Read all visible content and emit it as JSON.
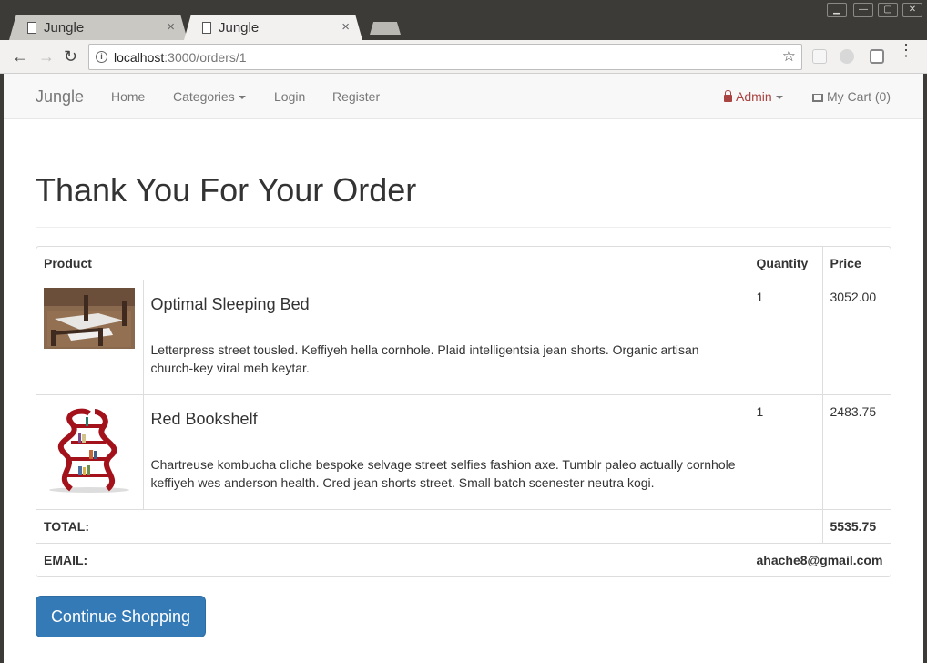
{
  "browser": {
    "tabs": [
      {
        "title": "Jungle",
        "close": "×"
      },
      {
        "title": "Jungle",
        "close": "×"
      }
    ],
    "url_host": "localhost",
    "url_path": ":3000/orders/1",
    "nav": {
      "back": "←",
      "forward": "→",
      "reload": "↻",
      "star": "☆",
      "menu": "⋮",
      "info": "i"
    },
    "window_controls": [
      "▁",
      "—",
      "▢",
      "✕"
    ]
  },
  "navbar": {
    "brand": "Jungle",
    "links": {
      "home": "Home",
      "categories": "Categories",
      "login": "Login",
      "register": "Register"
    },
    "admin": "Admin",
    "cart": "My Cart (0)"
  },
  "heading": "Thank You For Your Order",
  "table": {
    "headers": {
      "product": "Product",
      "quantity": "Quantity",
      "price": "Price"
    },
    "items": [
      {
        "name": "Optimal Sleeping Bed",
        "description": "Letterpress street tousled. Keffiyeh hella cornhole. Plaid intelligentsia jean shorts. Organic artisan church-key viral meh keytar.",
        "quantity": "1",
        "price": "3052.00"
      },
      {
        "name": "Red Bookshelf",
        "description": "Chartreuse kombucha cliche bespoke selvage street selfies fashion axe. Tumblr paleo actually cornhole keffiyeh wes anderson health. Cred jean shorts street. Small batch scenester neutra kogi.",
        "quantity": "1",
        "price": "2483.75"
      }
    ],
    "total_label": "TOTAL:",
    "total_value": "5535.75",
    "email_label": "EMAIL:",
    "email_value": "ahache8@gmail.com"
  },
  "continue_button": "Continue Shopping",
  "colors": {
    "primary": "#337ab7",
    "admin": "#a94442",
    "navbar_bg": "#f8f8f8"
  }
}
